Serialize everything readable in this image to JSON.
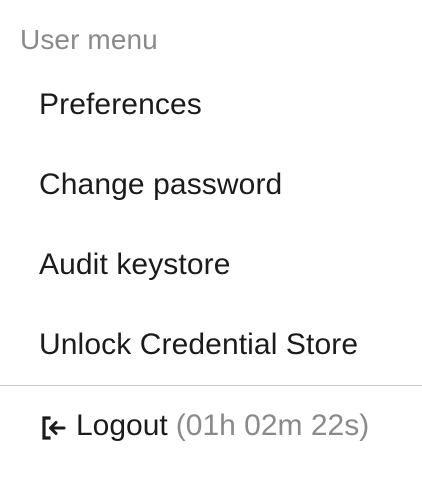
{
  "menu": {
    "header": "User menu",
    "items": [
      {
        "label": "Preferences"
      },
      {
        "label": "Change password"
      },
      {
        "label": "Audit keystore"
      },
      {
        "label": "Unlock Credential Store"
      }
    ],
    "logout": {
      "label": "Logout",
      "session_time": "(01h 02m 22s)",
      "icon": "logout-icon"
    }
  },
  "colors": {
    "text": "#1b1b1b",
    "muted": "#8a8a8a",
    "divider": "#c8c8c8",
    "background": "#ffffff"
  }
}
